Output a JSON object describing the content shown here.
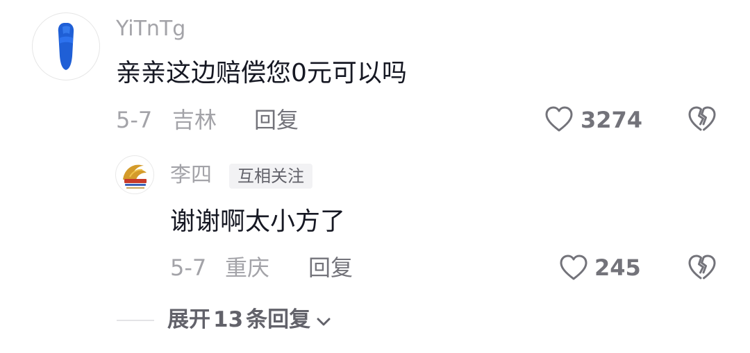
{
  "comment": {
    "username": "YiTnTg",
    "avatar_icon": "blue-slipper-icon",
    "text": "亲亲这边赔偿您0元可以吗",
    "date": "5-7",
    "location": "吉林",
    "reply_label": "回复",
    "like_count": "3274",
    "like_icon": "heart-outline-icon",
    "dislike_icon": "broken-heart-icon"
  },
  "reply": {
    "username": "李四",
    "avatar_icon": "gold-logo-avatar-icon",
    "badge": "互相关注",
    "text": "谢谢啊太小方了",
    "date": "5-7",
    "location": "重庆",
    "reply_label": "回复",
    "like_count": "245",
    "like_icon": "heart-outline-icon",
    "dislike_icon": "broken-heart-icon"
  },
  "expand": {
    "prefix": "展开",
    "count": "13",
    "suffix": "条回复",
    "icon": "chevron-down-icon"
  },
  "colors": {
    "text_primary": "#161823",
    "text_secondary": "#a3a3a8",
    "text_action": "#73737a",
    "slipper_blue": "#1f5fd6"
  }
}
